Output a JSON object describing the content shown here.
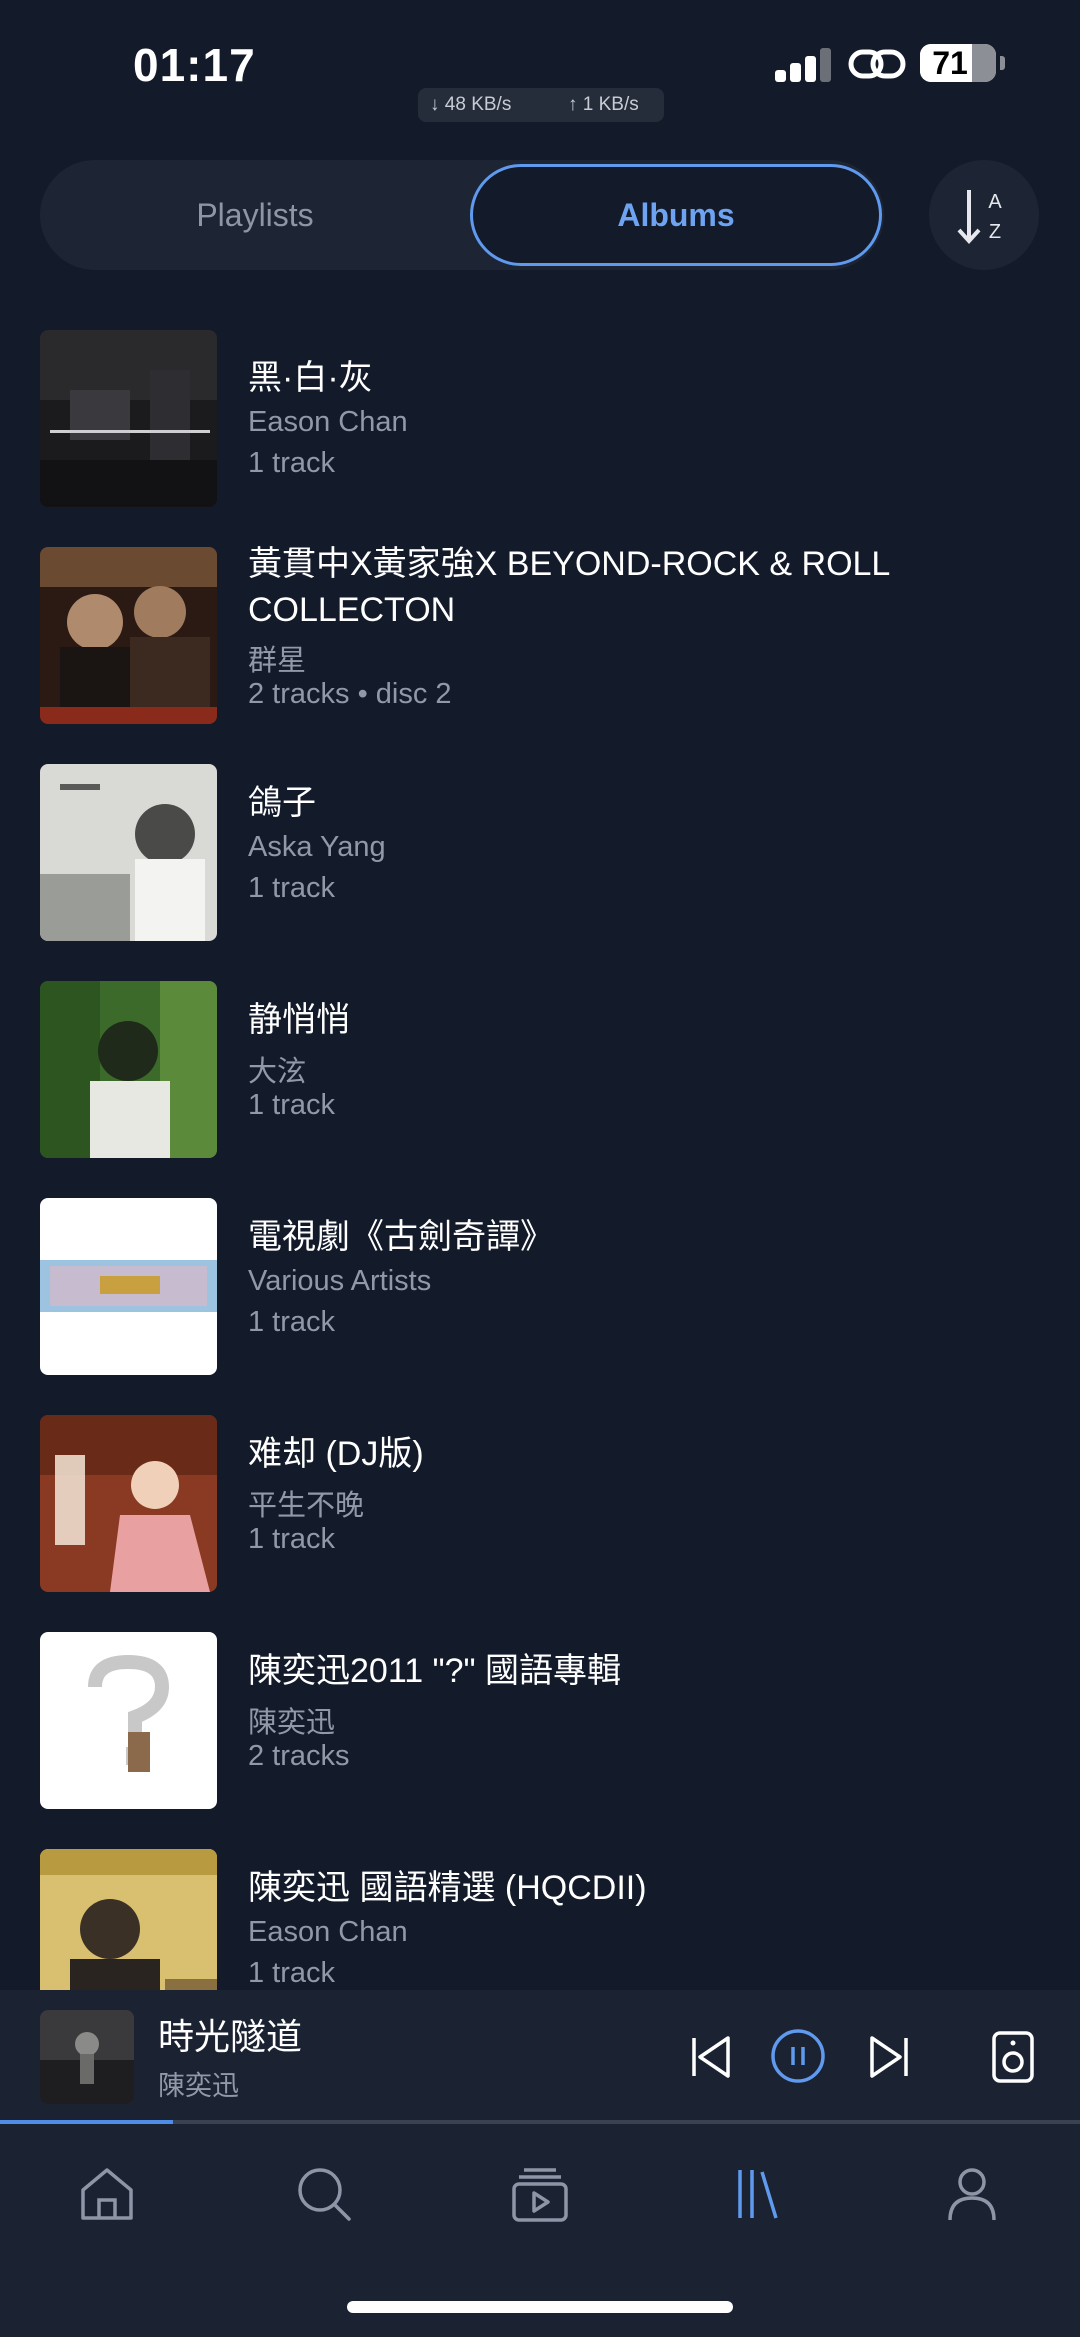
{
  "status_bar": {
    "time": "01:17",
    "battery": "71",
    "net_down": "↓ 48 KB/s",
    "net_up": "↑ 1 KB/s"
  },
  "segment": {
    "playlists": "Playlists",
    "albums": "Albums",
    "selected": "Albums"
  },
  "sort": {
    "icon": "sort-az-icon",
    "top_letter": "A",
    "bottom_letter": "Z"
  },
  "albums": [
    {
      "title": "黑·白·灰",
      "artist": "Eason Chan",
      "tracks": "1 track"
    },
    {
      "title": "黃貫中X黃家強X BEYOND-ROCK & ROLL COLLECTON",
      "artist": "群星",
      "tracks": "2 tracks • disc 2"
    },
    {
      "title": "鴿子",
      "artist": "Aska Yang",
      "tracks": "1 track"
    },
    {
      "title": "静悄悄",
      "artist": "大泫",
      "tracks": "1 track"
    },
    {
      "title": "電視劇《古劍奇譚》",
      "artist": "Various Artists",
      "tracks": "1 track"
    },
    {
      "title": "难却 (DJ版)",
      "artist": "平生不晚",
      "tracks": "1 track"
    },
    {
      "title": "陳奕迅2011 \"?\" 國語專輯",
      "artist": "陳奕迅",
      "tracks": "2 tracks"
    },
    {
      "title": "陳奕迅 國語精選 (HQCDII)",
      "artist": "Eason Chan",
      "tracks": "1 track"
    }
  ],
  "now_playing": {
    "title": "時光隧道",
    "artist": "陳奕迅",
    "progress": 0.16
  },
  "tabs": [
    {
      "name": "home",
      "icon": "home-icon"
    },
    {
      "name": "search",
      "icon": "search-icon"
    },
    {
      "name": "videos",
      "icon": "video-library-icon"
    },
    {
      "name": "library",
      "icon": "library-icon",
      "active": true
    },
    {
      "name": "profile",
      "icon": "person-icon"
    }
  ],
  "colors": {
    "background": "#131a2a",
    "accent": "#5f9aef",
    "secondary_text": "#9199a8"
  }
}
